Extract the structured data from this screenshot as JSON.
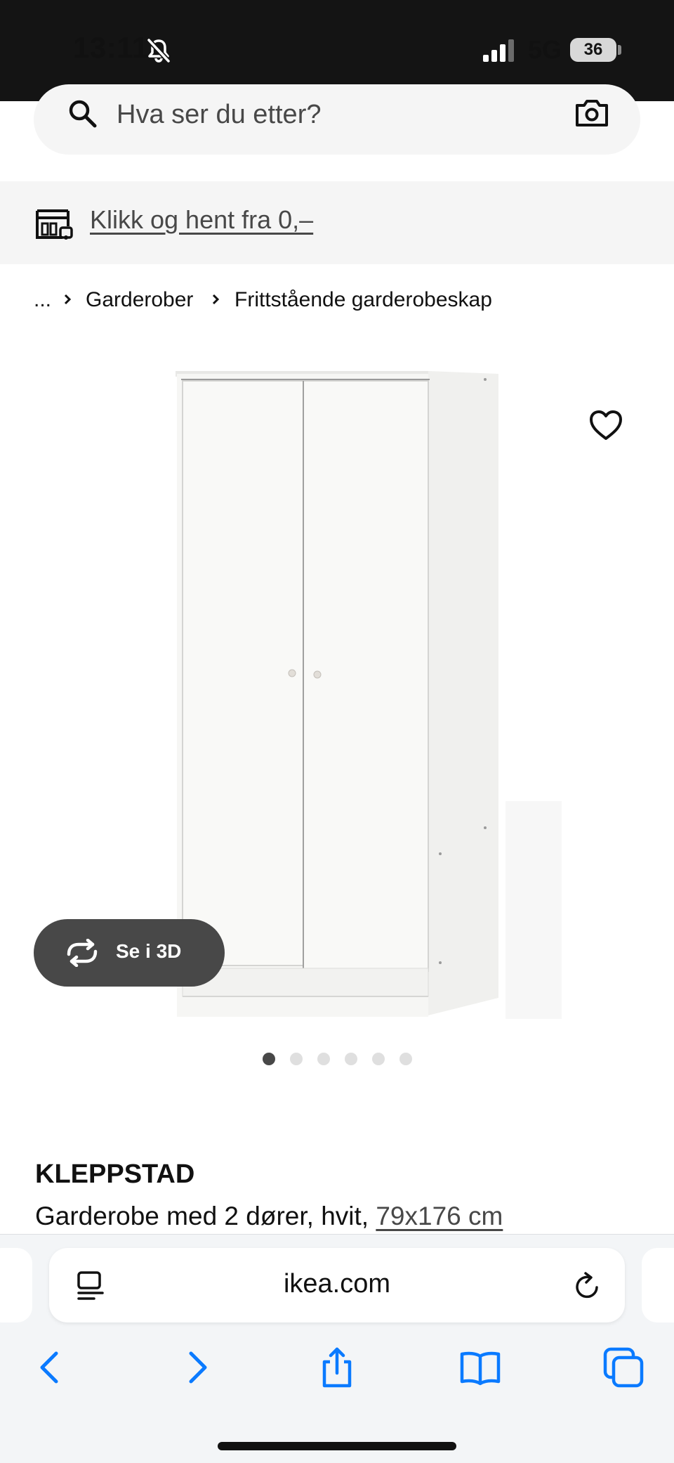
{
  "status_bar": {
    "time": "13:11",
    "network": "5G",
    "battery": "36"
  },
  "search": {
    "placeholder": "Hva ser du etter?"
  },
  "click_collect": {
    "label": "Klikk og hent fra 0,–"
  },
  "breadcrumb": {
    "items": [
      "...",
      "Garderober",
      "Frittstående garderobeskap"
    ]
  },
  "gallery": {
    "view_3d_label": "Se i 3D",
    "image_count": 6,
    "active_index": 0
  },
  "product": {
    "name": "KLEPPSTAD",
    "description": "Garderobe med 2 dører, hvit, ",
    "size": "79x176 cm"
  },
  "browser": {
    "url": "ikea.com"
  },
  "colors": {
    "status_bar_bg": "#141414",
    "surface_gray": "#f5f5f5",
    "pill_dark": "#484848",
    "safari_blue": "#0a7aff"
  }
}
